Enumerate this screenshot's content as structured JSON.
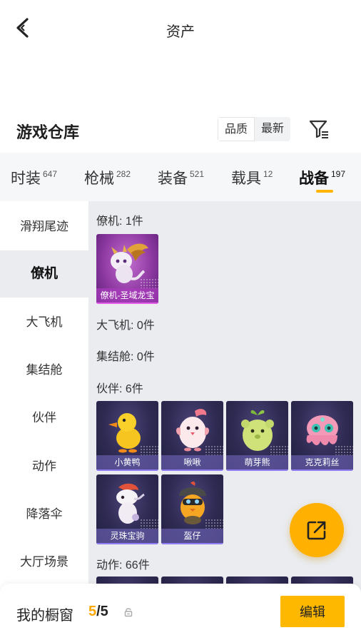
{
  "header": {
    "title": "资产"
  },
  "section": {
    "title": "游戏仓库",
    "sort_quality": "品质",
    "sort_latest": "最新"
  },
  "tabs": [
    {
      "label": "时装",
      "count": "647"
    },
    {
      "label": "枪械",
      "count": "282"
    },
    {
      "label": "装备",
      "count": "521"
    },
    {
      "label": "载具",
      "count": "12"
    },
    {
      "label": "战备",
      "count": "197",
      "active": true
    }
  ],
  "sidebar": [
    {
      "label": "滑翔尾迹"
    },
    {
      "label": "僚机",
      "active": true
    },
    {
      "label": "大飞机"
    },
    {
      "label": "集结舱"
    },
    {
      "label": "伙伴"
    },
    {
      "label": "动作"
    },
    {
      "label": "降落伞"
    },
    {
      "label": "大厅场景"
    }
  ],
  "groups": {
    "wingman": {
      "heading": "僚机: 1件",
      "items": [
        {
          "label": "僚机-圣域龙宝",
          "icon": "dragon-icon",
          "rarity": "purple"
        }
      ]
    },
    "big_plane": {
      "heading": "大飞机: 0件"
    },
    "assembly_pod": {
      "heading": "集结舱: 0件"
    },
    "partners": {
      "heading": "伙伴: 6件",
      "items": [
        {
          "label": "小黄鸭",
          "icon": "yellow-duck-icon"
        },
        {
          "label": "啾啾",
          "icon": "pink-bird-icon"
        },
        {
          "label": "萌芽熊",
          "icon": "sprout-bear-icon"
        },
        {
          "label": "克克莉丝",
          "icon": "octopus-icon"
        },
        {
          "label": "灵珠宝驹",
          "icon": "horse-icon"
        },
        {
          "label": "盔仔",
          "icon": "helmet-chick-icon"
        }
      ]
    },
    "actions": {
      "heading": "动作: 66件"
    }
  },
  "showcase": {
    "label": "我的橱窗",
    "current": "5",
    "total": "/5"
  },
  "edit_button": "编辑",
  "colors": {
    "accent": "#ffb400",
    "content_bg": "#eaecf0",
    "purple_rarity": "#8e3aa2",
    "card_bg": "#2e2a52"
  }
}
